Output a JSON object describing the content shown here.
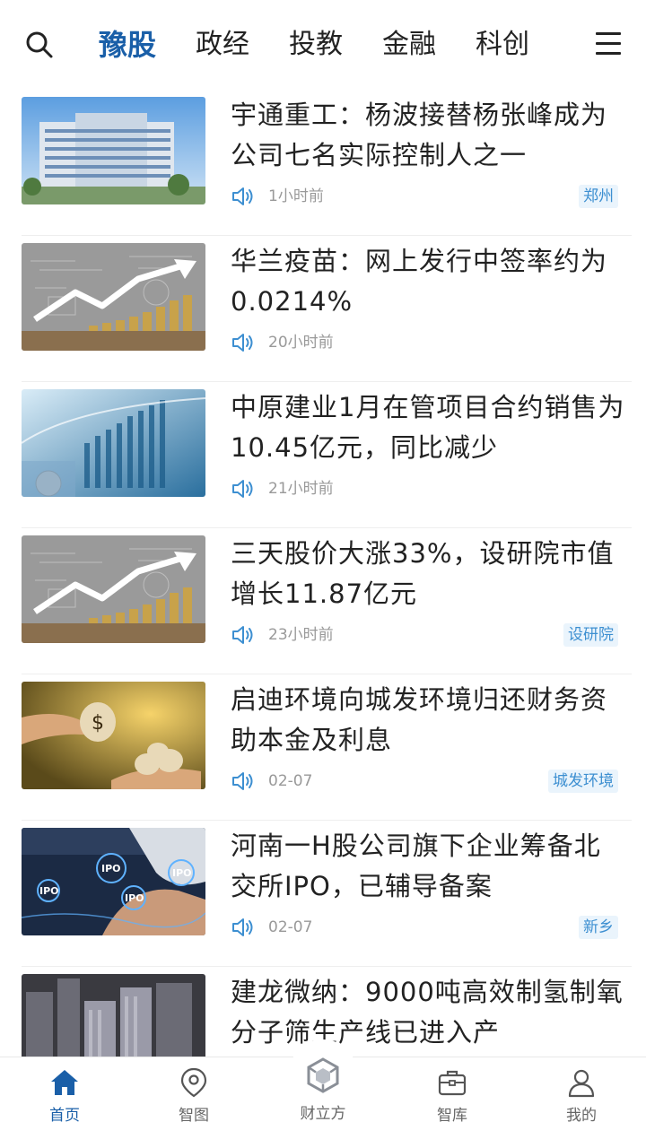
{
  "header": {
    "tabs": [
      {
        "label": "豫股",
        "active": true
      },
      {
        "label": "政经",
        "active": false
      },
      {
        "label": "投教",
        "active": false
      },
      {
        "label": "金融",
        "active": false
      },
      {
        "label": "科创",
        "active": false
      }
    ]
  },
  "news": [
    {
      "title": "宇通重工：杨波接替杨张峰成为公司七名实际控制人之一",
      "time": "1小时前",
      "tag": "郑州",
      "thumb": "office-building"
    },
    {
      "title": "华兰疫苗：网上发行中签率约为0.0214%",
      "time": "20小时前",
      "tag": "",
      "thumb": "coins-chart"
    },
    {
      "title": "中原建业1月在管项目合约销售为10.45亿元，同比减少",
      "time": "21小时前",
      "tag": "",
      "thumb": "finance-chart"
    },
    {
      "title": "三天股价大涨33%，设研院市值增长11.87亿元",
      "time": "23小时前",
      "tag": "设研院",
      "thumb": "coins-chart"
    },
    {
      "title": "启迪环境向城发环境归还财务资助本金及利息",
      "time": "02-07",
      "tag": "城发环境",
      "thumb": "money-bags"
    },
    {
      "title": "河南一H股公司旗下企业筹备北交所IPO，已辅导备案",
      "time": "02-07",
      "tag": "新乡",
      "thumb": "ipo"
    },
    {
      "title": "建龙微纳：9000吨高效制氢制氧分子筛生产线已进入产",
      "time": "",
      "tag": "",
      "thumb": "city-buildings"
    }
  ],
  "nav": [
    {
      "label": "首页",
      "icon": "home-icon",
      "active": true
    },
    {
      "label": "智图",
      "icon": "map-pin-icon",
      "active": false
    },
    {
      "label": "财立方",
      "icon": "cube-logo-icon",
      "active": false
    },
    {
      "label": "智库",
      "icon": "briefcase-icon",
      "active": false
    },
    {
      "label": "我的",
      "icon": "user-icon",
      "active": false
    }
  ],
  "colors": {
    "accent": "#1a5fa8",
    "tag_text": "#3d8fd1",
    "tag_bg": "#eaf4fc",
    "meta": "#999999"
  }
}
